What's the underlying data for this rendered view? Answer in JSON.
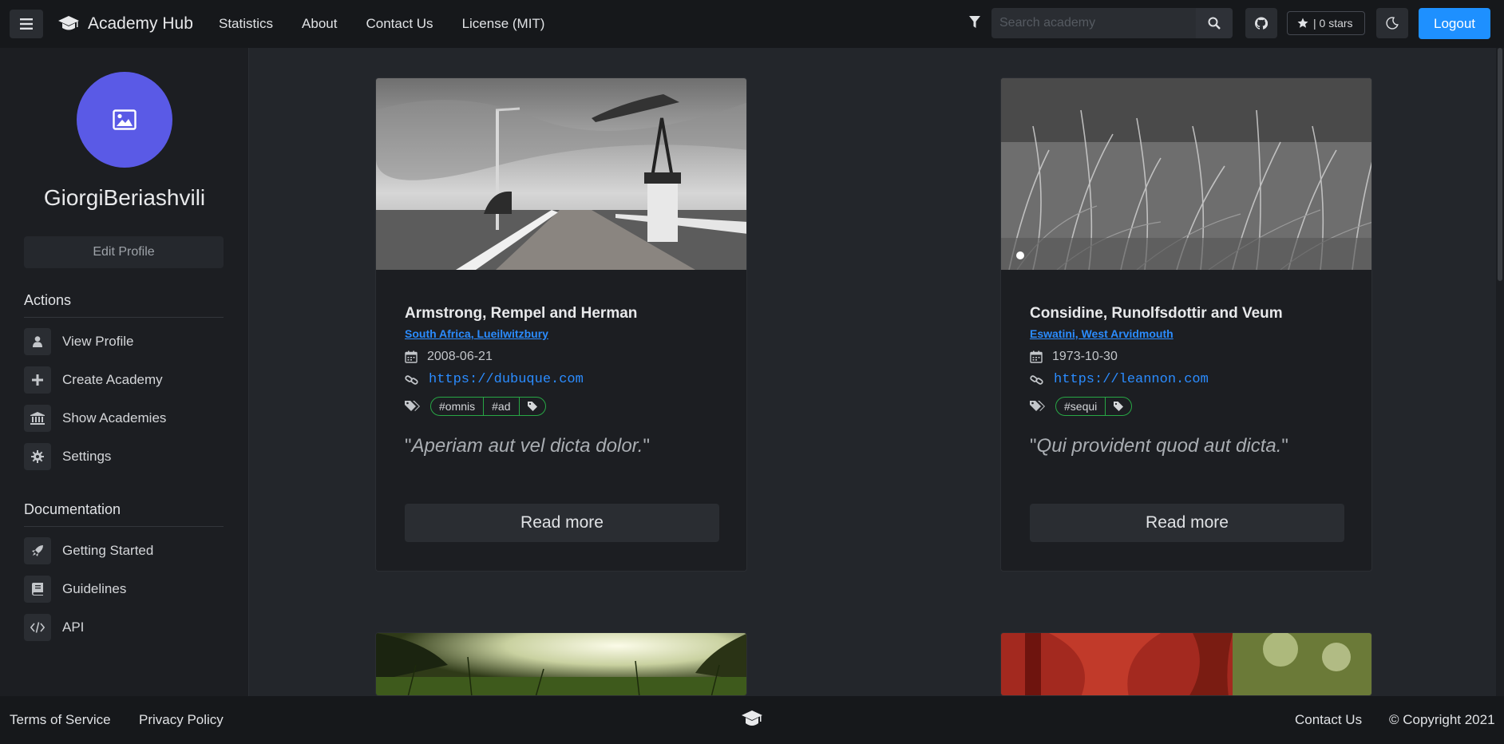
{
  "header": {
    "brand": "Academy Hub",
    "nav": [
      "Statistics",
      "About",
      "Contact Us",
      "License (MIT)"
    ],
    "search_placeholder": "Search academy",
    "stars_label": "| 0 stars",
    "logout_label": "Logout"
  },
  "sidebar": {
    "username": "GiorgiBeriashvili",
    "edit_profile": "Edit Profile",
    "actions_title": "Actions",
    "actions": [
      {
        "label": "View Profile",
        "icon": "user-icon"
      },
      {
        "label": "Create Academy",
        "icon": "plus-icon"
      },
      {
        "label": "Show Academies",
        "icon": "institution-icon"
      },
      {
        "label": "Settings",
        "icon": "gear-icon"
      }
    ],
    "docs_title": "Documentation",
    "docs": [
      {
        "label": "Getting Started",
        "icon": "rocket-icon"
      },
      {
        "label": "Guidelines",
        "icon": "book-icon"
      },
      {
        "label": "API",
        "icon": "code-icon"
      }
    ]
  },
  "cards": [
    {
      "title": "Armstrong, Rempel and Herman",
      "location": "South Africa, Lueilwitzbury",
      "date": "2008-06-21",
      "url": "https://dubuque.com",
      "tags": [
        "#omnis",
        "#ad"
      ],
      "quote": "Aperiam aut vel dicta dolor.",
      "read_more": "Read more"
    },
    {
      "title": "Considine, Runolfsdottir and Veum",
      "location": "Eswatini, West Arvidmouth",
      "date": "1973-10-30",
      "url": "https://leannon.com",
      "tags": [
        "#sequi"
      ],
      "quote": "Qui provident quod aut dicta.",
      "read_more": "Read more"
    }
  ],
  "footer": {
    "terms": "Terms of Service",
    "privacy": "Privacy Policy",
    "contact": "Contact Us",
    "copyright": "© Copyright 2021"
  },
  "colors": {
    "accent": "#1e90ff",
    "link": "#2b8cff",
    "tag_border": "#28a745",
    "avatar": "#5a5ae6"
  }
}
